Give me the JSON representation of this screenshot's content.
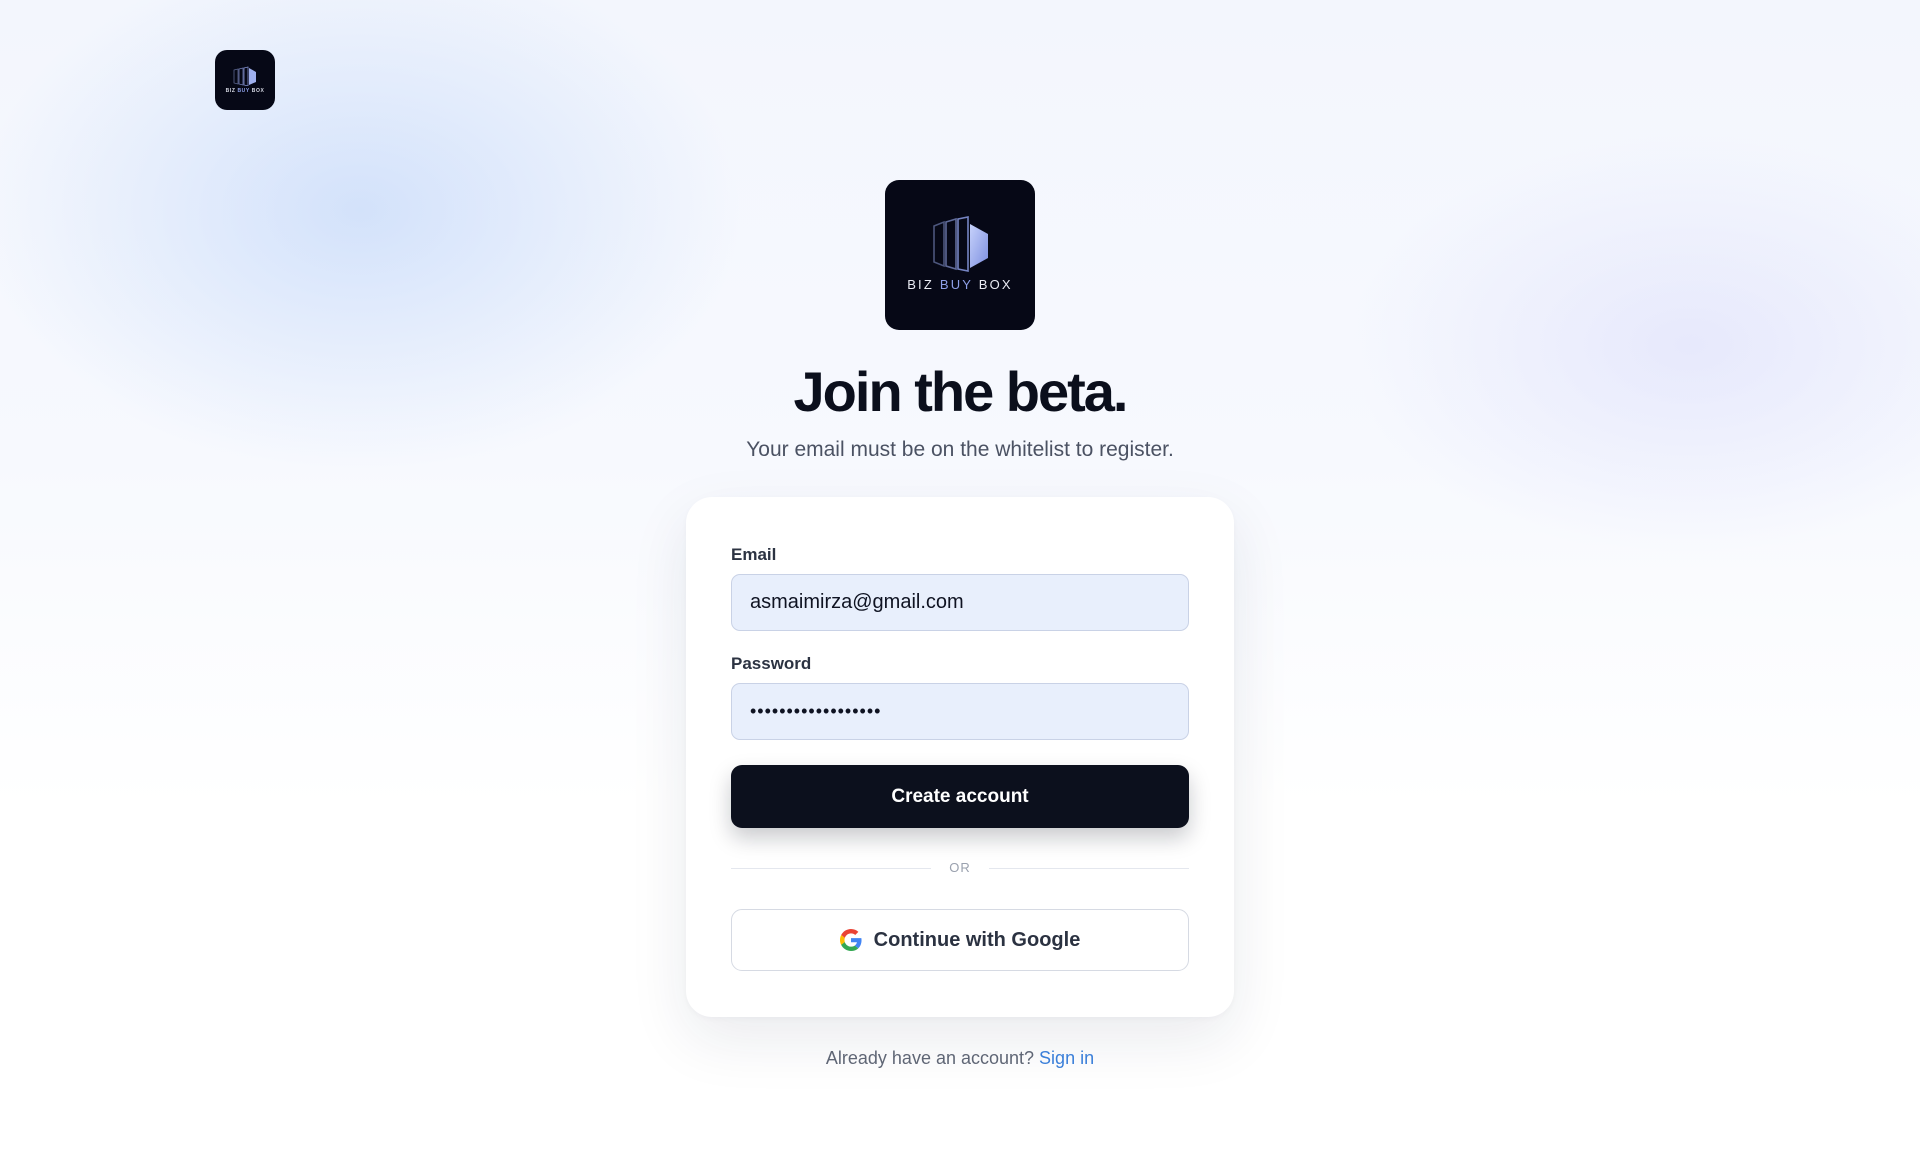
{
  "brand": {
    "wordmark_part1": "BIZ ",
    "wordmark_accent": "BUY",
    "wordmark_part3": " BOX",
    "logo_icon": "stacked-panels-icon",
    "accent_color": "#8ea0e8",
    "logo_background": "#060816"
  },
  "header": {
    "title": "Join the beta.",
    "subtitle": "Your email must be on the whitelist to register."
  },
  "form": {
    "email_label": "Email",
    "email_value": "asmaimirza@gmail.com",
    "password_label": "Password",
    "password_value": "••••••••••••••••••",
    "submit_label": "Create account",
    "divider_text": "OR",
    "google_label": "Continue with Google",
    "google_icon": "google-g-icon"
  },
  "footer": {
    "prompt": "Already have an account? ",
    "link_label": "Sign in",
    "link_color": "#3a7fd9"
  }
}
